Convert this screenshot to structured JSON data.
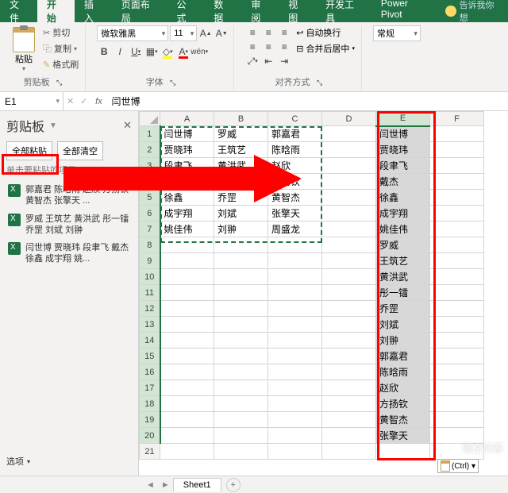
{
  "tabs": {
    "file": "文件",
    "home": "开始",
    "insert": "插入",
    "layout": "页面布局",
    "formulas": "公式",
    "data": "数据",
    "review": "审阅",
    "view": "视图",
    "dev": "开发工具",
    "powerpivot": "Power Pivot",
    "tellme": "告诉我你想"
  },
  "ribbon": {
    "paste": "粘贴",
    "cut": "剪切",
    "copy": "复制",
    "format_painter": "格式刷",
    "clipboard_group": "剪贴板",
    "font_name": "微软雅黑",
    "font_size": "11",
    "font_group": "字体",
    "wrap": "自动换行",
    "merge": "合并后居中",
    "align_group": "对齐方式",
    "number_format": "常规",
    "launcher": "⤡"
  },
  "namebox": "E1",
  "formula_value": "闫世博",
  "clip": {
    "title": "剪贴板",
    "paste_all": "全部粘贴",
    "clear_all": "全部清空",
    "hint": "单击要粘贴的项目:",
    "item1": "郭嘉君 陈晗雨 赵欣 方扬钦 黄智杰 张擎天 ...",
    "item2": "罗威 王筑艺 黄洪武 彤一镭 乔罡 刘斌 刘翀",
    "item3": "闫世博 贾晓玮 段聿飞 戴杰 徐鑫 成宇翔 姚...",
    "options": "选项"
  },
  "cols": [
    "A",
    "B",
    "C",
    "D",
    "E",
    "F"
  ],
  "abc": [
    [
      "闫世博",
      "罗威",
      "郭嘉君"
    ],
    [
      "贾晓玮",
      "王筑艺",
      "陈晗雨"
    ],
    [
      "段聿飞",
      "黄洪武",
      "赵欣"
    ],
    [
      "戴杰",
      "彤一镭",
      "方扬钦"
    ],
    [
      "徐鑫",
      "乔罡",
      "黄智杰"
    ],
    [
      "成宇翔",
      "刘斌",
      "张擎天"
    ],
    [
      "姚佳伟",
      "刘翀",
      "周盛龙"
    ]
  ],
  "colE": [
    "闫世博",
    "贾晓玮",
    "段聿飞",
    "戴杰",
    "徐鑫",
    "成宇翔",
    "姚佳伟",
    "罗威",
    "王筑艺",
    "黄洪武",
    "彤一镭",
    "乔罡",
    "刘斌",
    "刘翀",
    "郭嘉君",
    "陈晗雨",
    "赵欣",
    "方扬钦",
    "黄智杰",
    "张擎天"
  ],
  "sheet_name": "Sheet1",
  "ctrl_tag": "(Ctrl) ▾",
  "watermark": "悟空问答"
}
